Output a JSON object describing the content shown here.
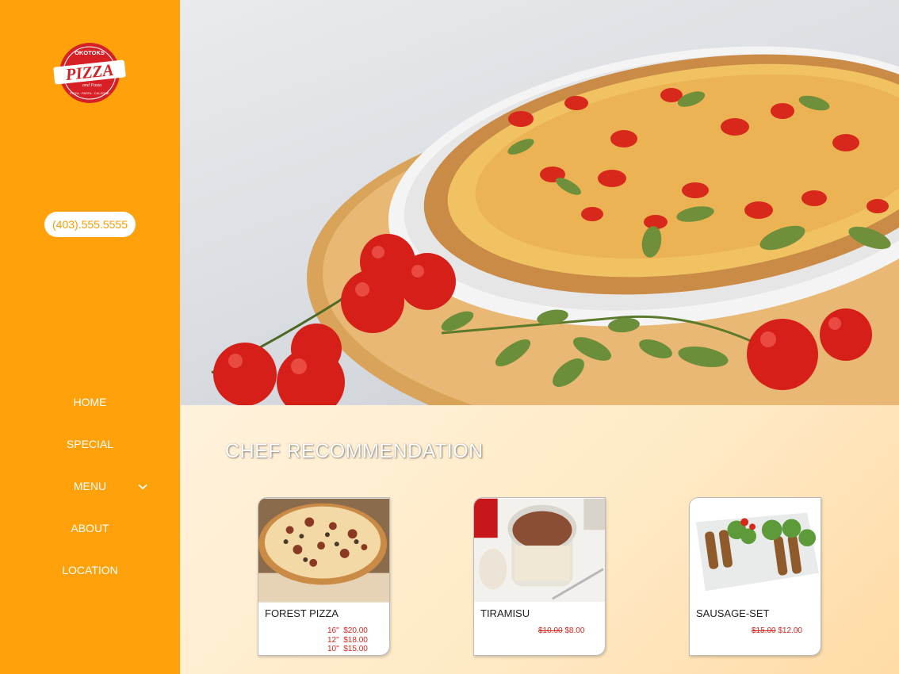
{
  "brand": {
    "logo_top": "OKOTOKS",
    "logo_main": "PIZZA",
    "logo_sub": "and Pasta",
    "logo_bottom": "PIZZA · PASTA · CALZONE"
  },
  "phone": "(403).555.5555",
  "nav": [
    {
      "label": "HOME"
    },
    {
      "label": "SPECIAL"
    },
    {
      "label": "MENU"
    },
    {
      "label": "ABOUT"
    },
    {
      "label": "LOCATION"
    }
  ],
  "section_title": "CHEF RECOMMENDATION",
  "cards": [
    {
      "name": "FOREST PIZZA",
      "prices": [
        {
          "size": "16\"",
          "price": "$20.00"
        },
        {
          "size": "12\"",
          "price": "$18.00"
        },
        {
          "size": "10\"",
          "price": "$15.00"
        }
      ]
    },
    {
      "name": "TIRAMISU",
      "old_price": "$10.00",
      "price": "$8.00"
    },
    {
      "name": "SAUSAGE-SET",
      "old_price": "$15.00",
      "price": "$12.00"
    }
  ],
  "colors": {
    "accent": "#ffa10a",
    "price": "#e0241b",
    "logo_red": "#d71f26"
  }
}
